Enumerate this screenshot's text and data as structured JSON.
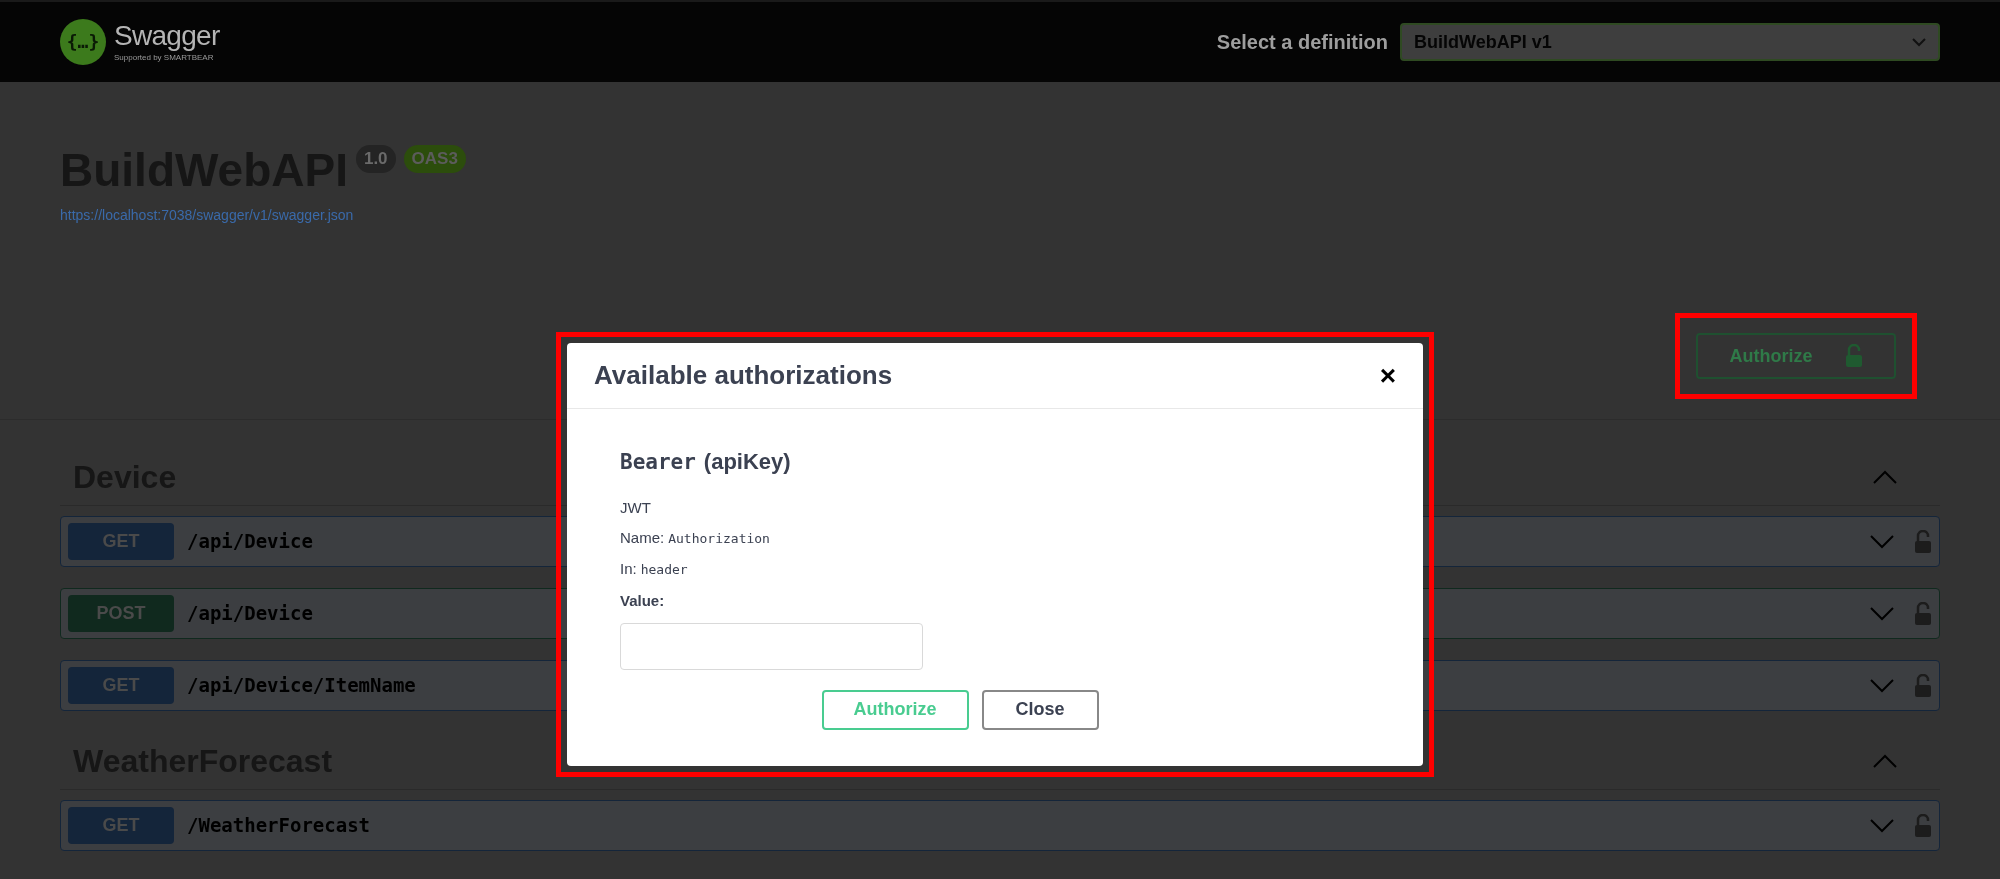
{
  "topbar": {
    "logo_glyph": "{…}",
    "logo_text": "Swagger",
    "logo_subtext": "Supported by SMARTBEAR",
    "definition_label": "Select a definition",
    "definition_value": "BuildWebAPI v1"
  },
  "info": {
    "title": "BuildWebAPI",
    "version": "1.0",
    "spec": "OAS3",
    "url": "https://localhost:7038/swagger/v1/swagger.json"
  },
  "authorize_button": {
    "label": "Authorize"
  },
  "sections": [
    {
      "name": "Device",
      "expanded": true,
      "operations": [
        {
          "method": "GET",
          "color": "#14253a",
          "path": "/api/Device",
          "expanded": false
        },
        {
          "method": "POST",
          "color": "#10291e",
          "path": "/api/Device",
          "expanded": false
        },
        {
          "method": "GET",
          "color": "#14253a",
          "path": "/api/Device/ItemName",
          "expanded": false
        }
      ]
    },
    {
      "name": "WeatherForecast",
      "expanded": true,
      "operations": [
        {
          "method": "GET",
          "color": "#14253a",
          "path": "/WeatherForecast",
          "expanded": false
        }
      ]
    }
  ],
  "modal": {
    "title": "Available authorizations",
    "close": "×",
    "scheme_name": "Bearer",
    "scheme_type": "(apiKey)",
    "description": "JWT",
    "name_label": "Name:",
    "name_value": "Authorization",
    "in_label": "In:",
    "in_value": "header",
    "value_label": "Value:",
    "buttons": [
      {
        "label": "Authorize",
        "kind": "primary"
      },
      {
        "label": "Close",
        "kind": "secondary"
      }
    ]
  }
}
